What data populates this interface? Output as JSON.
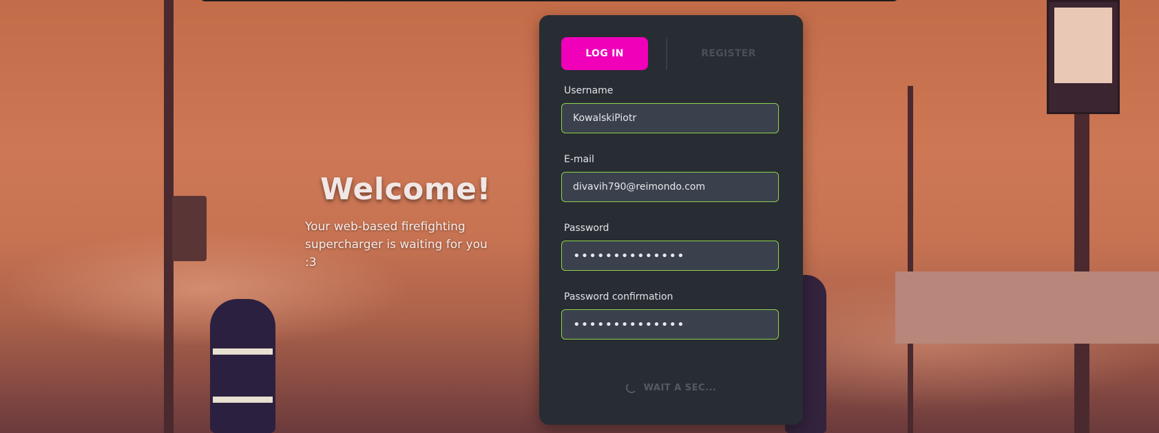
{
  "hero": {
    "title": "Welcome!",
    "subtitle": "Your web-based firefighting supercharger is waiting for you :3"
  },
  "auth": {
    "tabs": {
      "login_label": "LOG IN",
      "register_label": "REGISTER",
      "active": "login"
    },
    "fields": {
      "username": {
        "label": "Username",
        "value": "KowalskiPiotr"
      },
      "email": {
        "label": "E-mail",
        "value": "divavih790@reimondo.com"
      },
      "password": {
        "label": "Password",
        "value": "••••••••••••••"
      },
      "password_confirmation": {
        "label": "Password confirmation",
        "value": "••••••••••••••"
      }
    },
    "submit_status": "WAIT A SEC..."
  },
  "colors": {
    "accent": "#f000b8",
    "field_border": "#8fd44a",
    "panel_bg": "#282c33"
  }
}
